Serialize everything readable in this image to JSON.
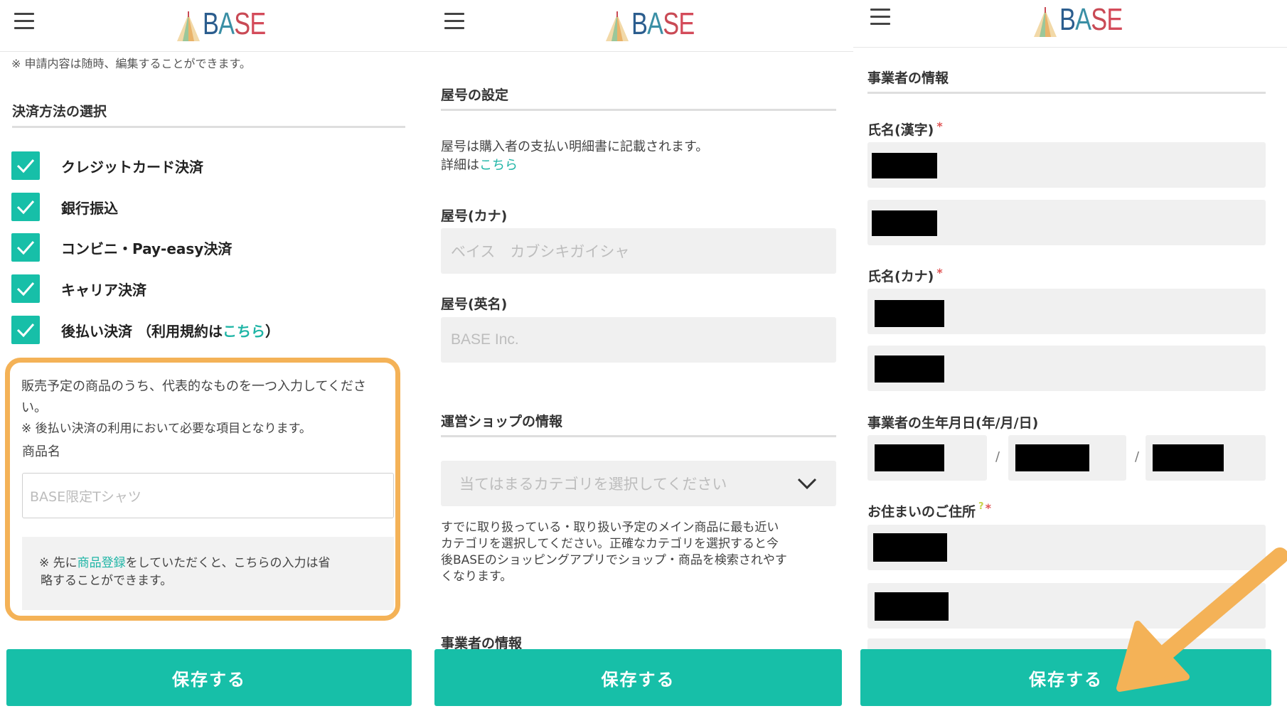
{
  "logo_text": {
    "b": "B",
    "a": "A",
    "s": "S",
    "e": "E"
  },
  "panel1": {
    "note_top": "※ 申請内容は随時、編集することができます。",
    "section_title": "決済方法の選択",
    "payments": [
      {
        "label": "クレジットカード決済",
        "checked": true
      },
      {
        "label": "銀行振込",
        "checked": true
      },
      {
        "label": "コンビニ・Pay-easy決済",
        "checked": true
      },
      {
        "label": "キャリア決済",
        "checked": true
      }
    ],
    "atobarai": {
      "label_pre": "後払い決済 （利用規約は",
      "link": "こちら",
      "label_post": "）",
      "checked": true
    },
    "product_desc_1": "販売予定の商品のうち、代表的なものを一つ入力してくださ",
    "product_desc_2": "い。",
    "product_desc_3": "※ 後払い決済の利用において必要な項目となります。",
    "product_name_label": "商品名",
    "product_name_placeholder": "BASE限定Tシャツ",
    "note_pre": "※ 先に",
    "note_link": "商品登録",
    "note_post_1": "をしていただくと、こちらの入力は省",
    "note_post_2": "略することができます。",
    "save_label": "保存する"
  },
  "panel2": {
    "section1_title": "屋号の設定",
    "desc1": "屋号は購入者の支払い明細書に記載されます。",
    "desc2_pre": "詳細は",
    "desc2_link": "こちら",
    "kana_label": "屋号(カナ)",
    "kana_placeholder": "ベイス　カブシキガイシャ",
    "en_label": "屋号(英名)",
    "en_placeholder": "BASE Inc.",
    "section2_title": "運営ショップの情報",
    "category_placeholder": "当てはまるカテゴリを選択してください",
    "category_desc_1": "すでに取り扱っている・取り扱い予定のメイン商品に最も近い",
    "category_desc_2": "カテゴリを選択してください。正確なカテゴリを選択すると今",
    "category_desc_3": "後BASEのショッピングアプリでショップ・商品を検索されやす",
    "category_desc_4": "くなります。",
    "section3_title": "事業者の情報",
    "save_label": "保存する"
  },
  "panel3": {
    "section_title": "事業者の情報",
    "name_kanji_label": "氏名(漢字)",
    "name_kana_label": "氏名(カナ)",
    "birthday_label": "事業者の生年月日(年/月/日)",
    "date_sep": "/",
    "address_label": "お住まいのご住所",
    "help_mark": "?",
    "required_mark": "*",
    "save_label": "保存する"
  },
  "colors": {
    "accent": "#17bfa8",
    "highlight": "#f4b257",
    "link": "#1fb5a6",
    "required": "#e05555"
  }
}
